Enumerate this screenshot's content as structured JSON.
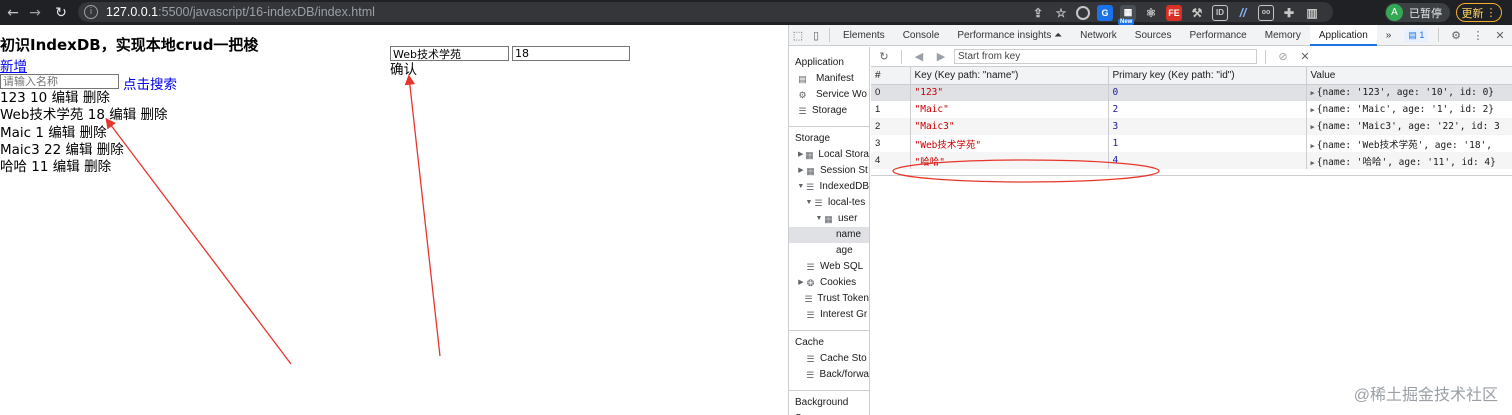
{
  "browser": {
    "url_host": "127.0.0.1",
    "url_path": ":5500/javascript/16-indexDB/index.html",
    "profile_initial": "A",
    "profile_label": "已暂停",
    "update_label": "更新",
    "ext_new_badge": "New",
    "ext_fe_label": "FE",
    "ext_id_label": "ID"
  },
  "page": {
    "heading": "初识IndexDB，实现本地crud一把梭",
    "add_link": "新增",
    "search_placeholder": "请输入名称",
    "search_link": "点击搜索",
    "records": [
      {
        "name": "123",
        "age": "10",
        "edit": "编辑",
        "delete": "删除"
      },
      {
        "name": "Web技术学苑",
        "age": "18",
        "edit": "编辑",
        "delete": "删除"
      },
      {
        "name": "Maic",
        "age": "1",
        "edit": "编辑",
        "delete": "删除"
      },
      {
        "name": "Maic3",
        "age": "22",
        "edit": "编辑",
        "delete": "删除"
      },
      {
        "name": "哈哈",
        "age": "11",
        "edit": "编辑",
        "delete": "删除"
      }
    ],
    "form": {
      "name_value": "Web技术学苑",
      "age_value": "18",
      "confirm_label": "确认"
    }
  },
  "devtools": {
    "tabs": [
      "Elements",
      "Console",
      "Performance insights ⏶",
      "Network",
      "Sources",
      "Performance",
      "Memory",
      "Application"
    ],
    "active_tab": "Application",
    "more_tabs": "»",
    "issues_count": "1",
    "sidebar": {
      "application_title": "Application",
      "application_items": [
        "Manifest",
        "Service Wo",
        "Storage"
      ],
      "storage_title": "Storage",
      "storage_items": [
        "Local Stora",
        "Session St",
        "IndexedDB",
        "local-tes",
        "user",
        "name",
        "age",
        "Web SQL",
        "Cookies",
        "Trust Token",
        "Interest Gr"
      ],
      "cache_title": "Cache",
      "cache_items": [
        "Cache Sto",
        "Back/forwa"
      ],
      "background_title": "Background Serv"
    },
    "toolbar": {
      "start_key_placeholder": "Start from key"
    },
    "table": {
      "headers": [
        "#",
        "Key (Key path: \"name\")",
        "Primary key (Key path: \"id\")",
        "Value"
      ],
      "rows": [
        {
          "index": "0",
          "key": "\"123\"",
          "primary_key": "0",
          "value": "{name: '123', age: '10', id: 0}"
        },
        {
          "index": "1",
          "key": "\"Maic\"",
          "primary_key": "2",
          "value": "{name: 'Maic', age: '1', id: 2}"
        },
        {
          "index": "2",
          "key": "\"Maic3\"",
          "primary_key": "3",
          "value": "{name: 'Maic3', age: '22', id: 3"
        },
        {
          "index": "3",
          "key": "\"Web技术学苑\"",
          "primary_key": "1",
          "value": "{name: 'Web技术学苑', age: '18',"
        },
        {
          "index": "4",
          "key": "\"哈哈\"",
          "primary_key": "4",
          "value": "{name: '哈哈', age: '11', id: 4}"
        }
      ]
    },
    "watermark": "@稀土掘金技术社区"
  },
  "colors": {
    "link": "#0000ee",
    "annotation": "#e8352b",
    "devtools_accent": "#1a73e8",
    "string_value": "#c80000",
    "number_value": "#1a1aa6"
  }
}
